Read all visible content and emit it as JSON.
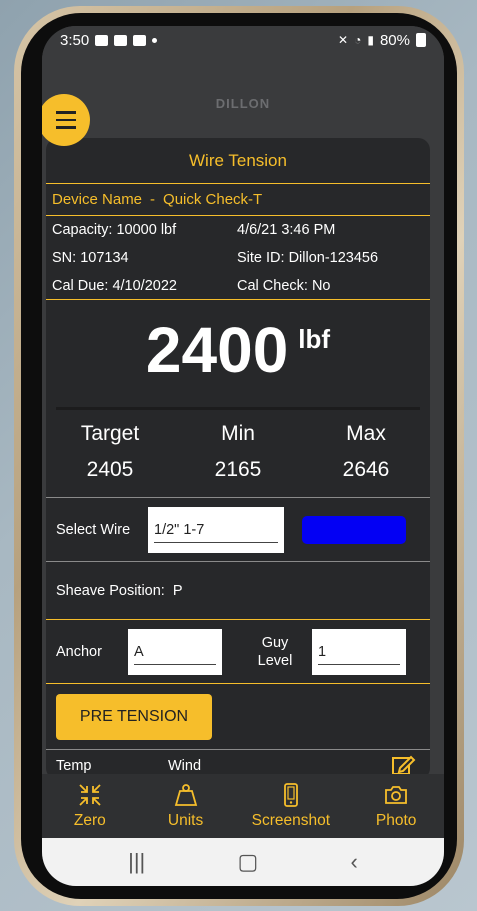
{
  "status_bar": {
    "time": "3:50",
    "battery": "80%"
  },
  "brand": "DILLON",
  "card": {
    "title": "Wire Tension",
    "device_label": "Device Name",
    "device_sep": "-",
    "device_name": "Quick Check-T",
    "info": {
      "capacity": "Capacity: 10000 lbf",
      "datetime": "4/6/21 3:46 PM",
      "sn": "SN: 107134",
      "site_id": "Site ID: Dillon-123456",
      "cal_due": "Cal Due:  4/10/2022",
      "cal_check": "Cal Check: No"
    },
    "reading": {
      "value": "2400",
      "unit": "lbf"
    },
    "tmm": {
      "target_label": "Target",
      "target_value": "2405",
      "min_label": "Min",
      "min_value": "2165",
      "max_label": "Max",
      "max_value": "2646"
    },
    "wire": {
      "label": "Select Wire",
      "value": "1/2\" 1-7",
      "color": "#0300f4"
    },
    "sheave": {
      "label": "Sheave Position:",
      "value": "P"
    },
    "anchor": {
      "label": "Anchor",
      "value": "A",
      "guy_label_1": "Guy",
      "guy_label_2": "Level",
      "guy_value": "1"
    },
    "pre_tension_label": "PRE TENSION",
    "peek": {
      "temp": "Temp",
      "wind": "Wind"
    }
  },
  "bottom_nav": [
    {
      "label": "Zero",
      "icon": "zero-icon"
    },
    {
      "label": "Units",
      "icon": "weight-icon"
    },
    {
      "label": "Screenshot",
      "icon": "phone-icon"
    },
    {
      "label": "Photo",
      "icon": "camera-icon"
    }
  ],
  "colors": {
    "accent": "#f6be2b",
    "card": "#27282a",
    "background": "#3a3b3d"
  }
}
